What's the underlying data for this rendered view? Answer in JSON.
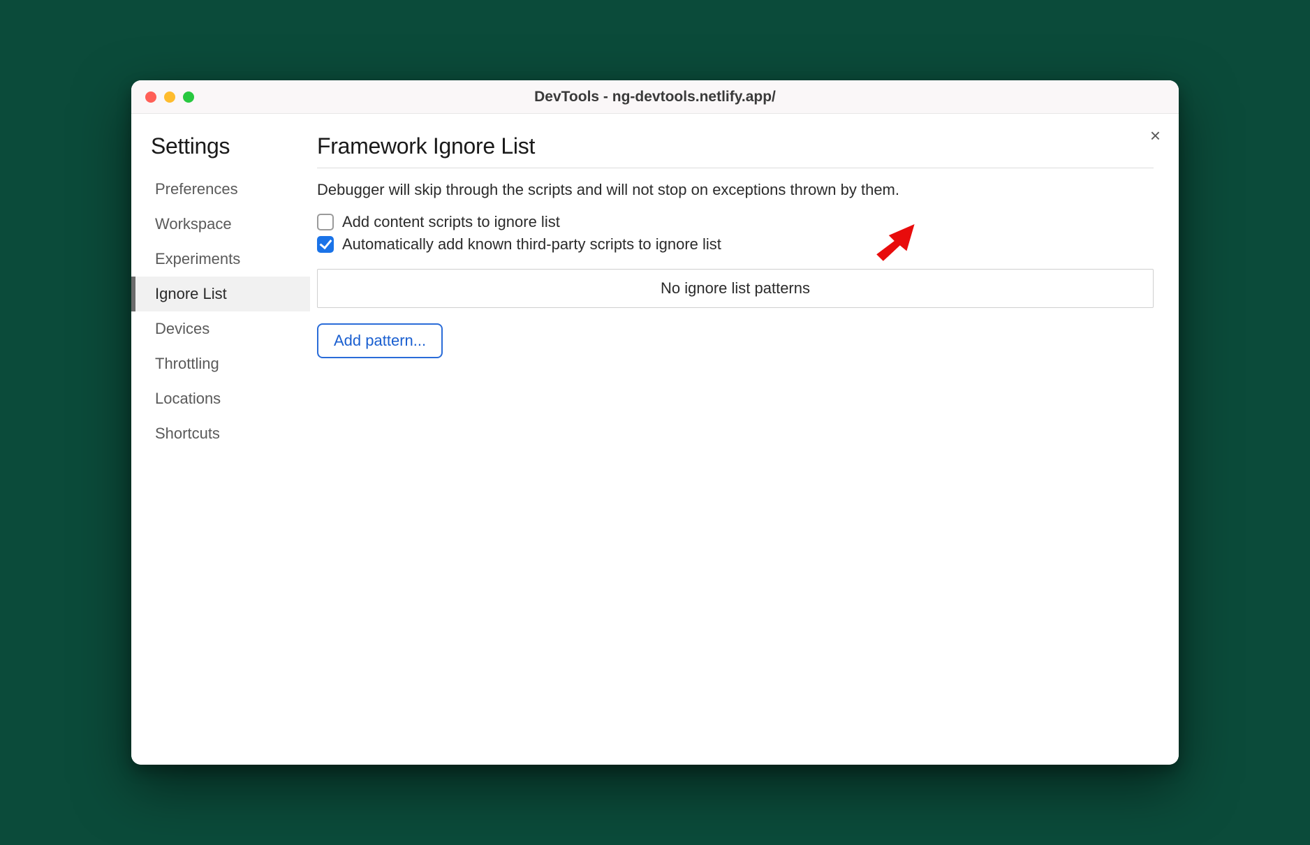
{
  "window": {
    "title": "DevTools - ng-devtools.netlify.app/"
  },
  "sidebar": {
    "title": "Settings",
    "items": [
      {
        "label": "Preferences",
        "active": false
      },
      {
        "label": "Workspace",
        "active": false
      },
      {
        "label": "Experiments",
        "active": false
      },
      {
        "label": "Ignore List",
        "active": true
      },
      {
        "label": "Devices",
        "active": false
      },
      {
        "label": "Throttling",
        "active": false
      },
      {
        "label": "Locations",
        "active": false
      },
      {
        "label": "Shortcuts",
        "active": false
      }
    ]
  },
  "main": {
    "title": "Framework Ignore List",
    "description": "Debugger will skip through the scripts and will not stop on exceptions thrown by them.",
    "checkboxes": [
      {
        "label": "Add content scripts to ignore list",
        "checked": false
      },
      {
        "label": "Automatically add known third-party scripts to ignore list",
        "checked": true
      }
    ],
    "patterns_empty": "No ignore list patterns",
    "add_pattern_label": "Add pattern..."
  },
  "close_label": "×",
  "annotation": {
    "type": "arrow",
    "color": "#e80c0c"
  }
}
